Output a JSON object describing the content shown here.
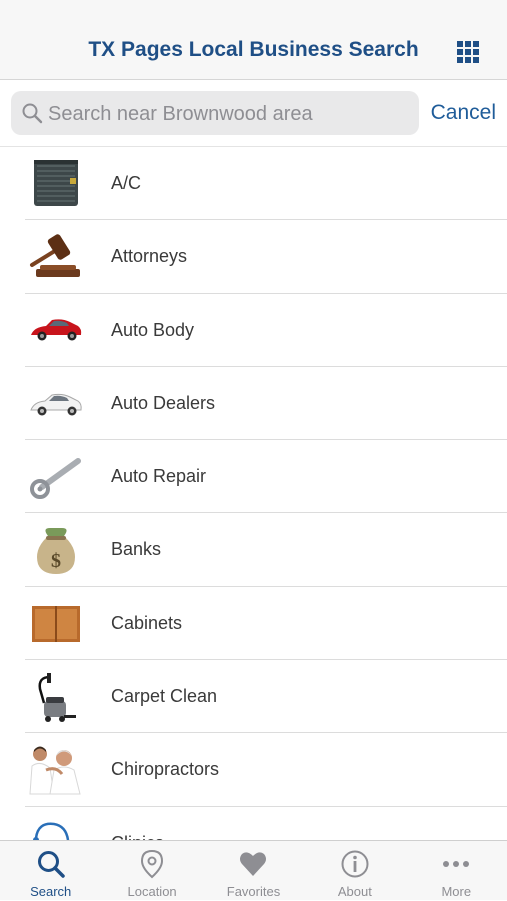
{
  "header": {
    "title": "TX Pages Local Business Search",
    "grid_icon": "grid-icon"
  },
  "search": {
    "placeholder": "Search near Brownwood area",
    "value": "",
    "cancel_label": "Cancel"
  },
  "categories": [
    {
      "label": "A/C",
      "icon": "ac-unit-icon"
    },
    {
      "label": "Attorneys",
      "icon": "gavel-icon"
    },
    {
      "label": "Auto Body",
      "icon": "red-car-icon"
    },
    {
      "label": "Auto Dealers",
      "icon": "white-car-icon"
    },
    {
      "label": "Auto Repair",
      "icon": "wrench-icon"
    },
    {
      "label": "Banks",
      "icon": "money-bag-icon"
    },
    {
      "label": "Cabinets",
      "icon": "cabinet-icon"
    },
    {
      "label": "Carpet Clean",
      "icon": "vacuum-icon"
    },
    {
      "label": "Chiropractors",
      "icon": "chiropractor-icon"
    },
    {
      "label": "Clinics",
      "icon": "stethoscope-icon"
    }
  ],
  "tabs": [
    {
      "label": "Search",
      "icon": "search-icon",
      "active": true
    },
    {
      "label": "Location",
      "icon": "location-pin-icon",
      "active": false
    },
    {
      "label": "Favorites",
      "icon": "heart-icon",
      "active": false
    },
    {
      "label": "About",
      "icon": "info-icon",
      "active": false
    },
    {
      "label": "More",
      "icon": "more-dots-icon",
      "active": false
    }
  ],
  "colors": {
    "accent": "#1f4f86",
    "link": "#1f5c99",
    "inactive": "#8e8e93"
  }
}
